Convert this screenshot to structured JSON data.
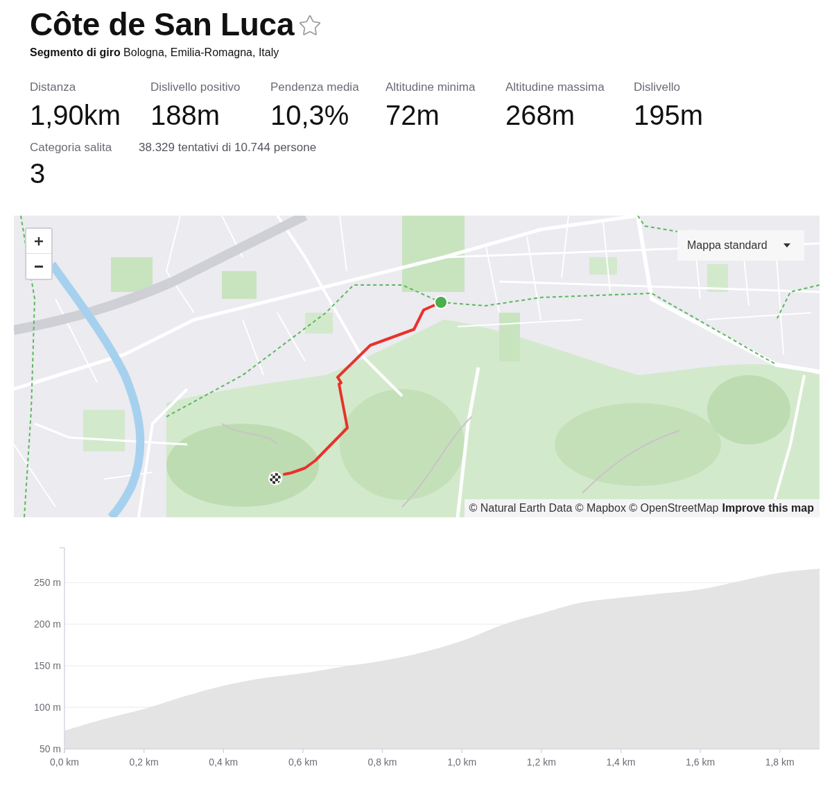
{
  "segment": {
    "title": "Côte de San Luca",
    "starred": false,
    "subtitle": "**Segmento di giro** Bologna, Emilia-Romagna, Italy"
  },
  "stats": [
    {
      "label": "Distanza",
      "value": "1,90km"
    },
    {
      "label": "Dislivello positivo",
      "value": "188m"
    },
    {
      "label": "Pendenza media",
      "value": "10,3%"
    },
    {
      "label": "Altitudine minima",
      "value": "72m"
    },
    {
      "label": "Altitudine massima",
      "value": "268m"
    },
    {
      "label": "Dislivello",
      "value": "195m"
    }
  ],
  "climb": {
    "category_label": "Categoria salita",
    "category_value": "3",
    "attempts": "38.329 tentativi di 10.744 persone"
  },
  "map": {
    "style_select": "Mappa standard",
    "attribution": "© Natural Earth Data © Mapbox © OpenStreetMap",
    "attribution_link": "Improve this map"
  },
  "elevation_profile": {
    "chart_data": {
      "type": "area",
      "x": [
        0,
        0.1,
        0.2,
        0.3,
        0.4,
        0.5,
        0.6,
        0.7,
        0.8,
        0.9,
        1.0,
        1.1,
        1.2,
        1.3,
        1.4,
        1.5,
        1.6,
        1.7,
        1.8,
        1.9
      ],
      "series": [
        {
          "color": "#e4e4e4",
          "values": [
            72,
            86,
            98,
            113,
            126,
            135,
            141,
            149,
            156,
            166,
            180,
            199,
            213,
            226,
            232,
            237,
            242,
            252,
            262,
            267
          ]
        }
      ],
      "xlim": [
        0,
        1.9
      ],
      "ylim": [
        50,
        292
      ],
      "xticks": [
        {
          "value": 0,
          "label": "0,0 km"
        },
        {
          "value": 0.2,
          "label": "0,2 km"
        },
        {
          "value": 0.4,
          "label": "0,4 km"
        },
        {
          "value": 0.6,
          "label": "0,6 km"
        },
        {
          "value": 0.8,
          "label": "0,8 km"
        },
        {
          "value": 1.0,
          "label": "1,0 km"
        },
        {
          "value": 1.2,
          "label": "1,2 km"
        },
        {
          "value": 1.4,
          "label": "1,4 km"
        },
        {
          "value": 1.6,
          "label": "1,6 km"
        },
        {
          "value": 1.8,
          "label": "1,8 km"
        }
      ],
      "yticks": [
        {
          "value": 50,
          "label": "50 m"
        },
        {
          "value": 100,
          "label": "100 m"
        },
        {
          "value": 150,
          "label": "150 m"
        },
        {
          "value": 200,
          "label": "200 m"
        },
        {
          "value": 250,
          "label": "250 m"
        }
      ],
      "grid": true
    }
  }
}
